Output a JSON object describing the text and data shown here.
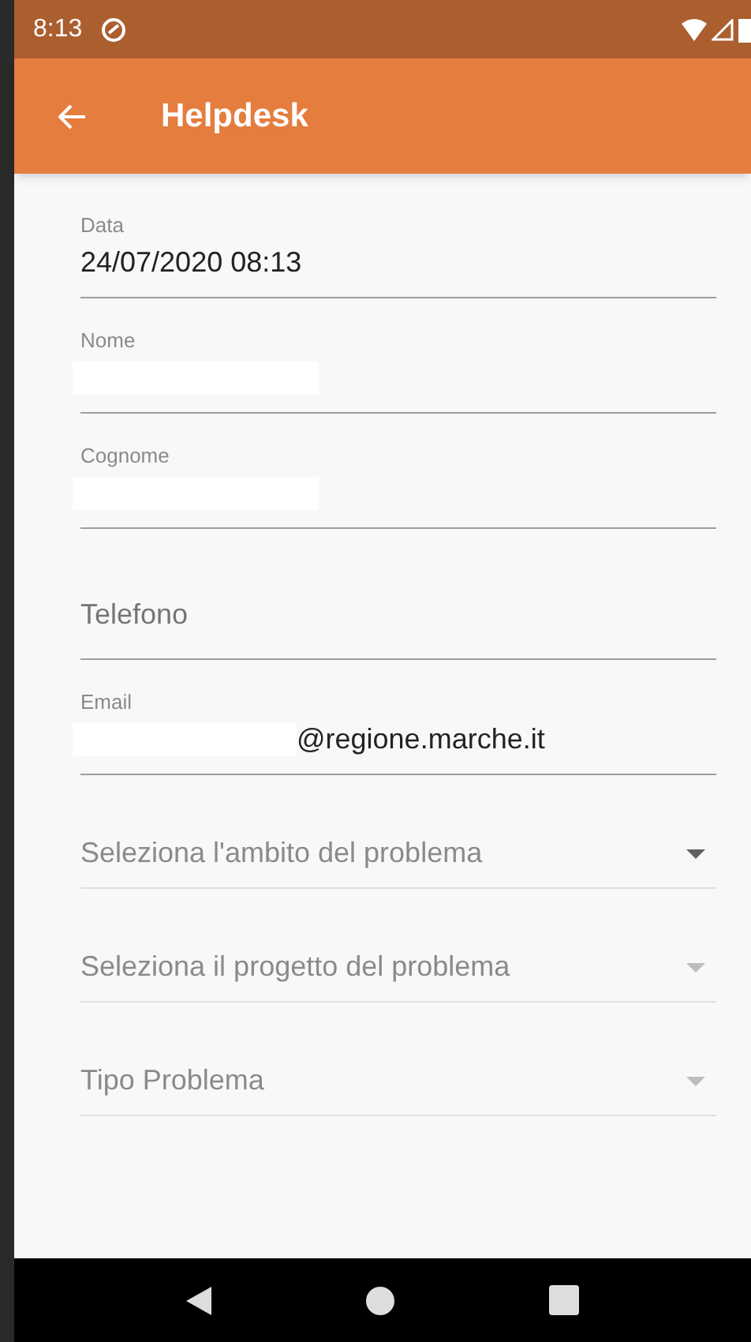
{
  "status_bar": {
    "time": "8:13"
  },
  "app_bar": {
    "title": "Helpdesk"
  },
  "fields": [
    {
      "kind": "text",
      "label": "Data",
      "value": "24/07/2020 08:13"
    },
    {
      "kind": "text",
      "label": "Nome",
      "redacted": true
    },
    {
      "kind": "text",
      "label": "Cognome",
      "redacted": true
    },
    {
      "kind": "text",
      "placeholder": "Telefono"
    },
    {
      "kind": "text",
      "label": "Email",
      "value": "@regione.marche.it",
      "redacted": true
    },
    {
      "kind": "dropdown",
      "placeholder": "Seleziona l'ambito del problema",
      "disabled": false
    },
    {
      "kind": "dropdown",
      "placeholder": "Seleziona il progetto del problema",
      "disabled": true
    },
    {
      "kind": "dropdown",
      "placeholder": "Tipo Problema",
      "disabled": true
    }
  ]
}
